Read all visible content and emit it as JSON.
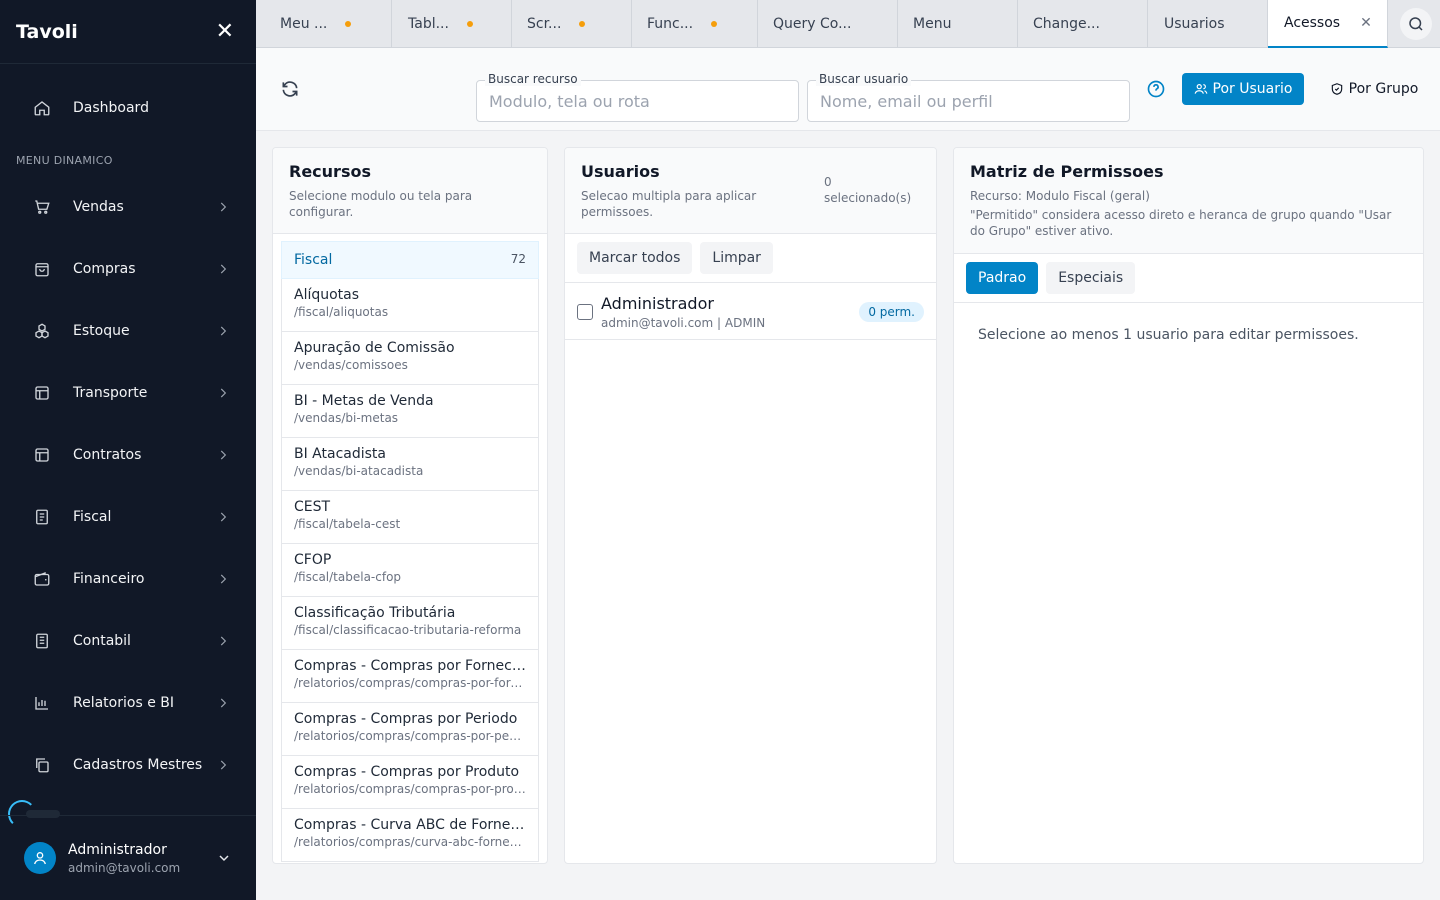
{
  "app": {
    "name": "Tavoli"
  },
  "sidebar": {
    "dashboard": "Dashboard",
    "section_title": "MENU DINAMICO",
    "items": [
      {
        "label": "Vendas",
        "icon": "cart-icon"
      },
      {
        "label": "Compras",
        "icon": "shopping-bag-icon"
      },
      {
        "label": "Estoque",
        "icon": "boxes-icon"
      },
      {
        "label": "Transporte",
        "icon": "layout-icon"
      },
      {
        "label": "Contratos",
        "icon": "layout-icon"
      },
      {
        "label": "Fiscal",
        "icon": "document-icon"
      },
      {
        "label": "Financeiro",
        "icon": "wallet-icon"
      },
      {
        "label": "Contabil",
        "icon": "ledger-icon"
      },
      {
        "label": "Relatorios e BI",
        "icon": "bar-chart-icon"
      },
      {
        "label": "Cadastros Mestres",
        "icon": "copy-icon"
      }
    ],
    "user": {
      "name": "Administrador",
      "email": "admin@tavoli.com"
    }
  },
  "tabs": [
    {
      "label": "Meu ...",
      "dirty": true
    },
    {
      "label": "Tabl...",
      "dirty": true
    },
    {
      "label": "Scr...",
      "dirty": true
    },
    {
      "label": "Func...",
      "dirty": true
    },
    {
      "label": "Query Co...",
      "dirty": false
    },
    {
      "label": "Menu",
      "dirty": false
    },
    {
      "label": "Change...",
      "dirty": false
    },
    {
      "label": "Usuarios",
      "dirty": false
    },
    {
      "label": "Acessos",
      "dirty": false,
      "active": true
    }
  ],
  "toolbar": {
    "search_resource": {
      "label": "Buscar recurso",
      "placeholder": "Modulo, tela ou rota",
      "value": ""
    },
    "search_user": {
      "label": "Buscar usuario",
      "placeholder": "Nome, email ou perfil",
      "value": ""
    },
    "by_user": "Por Usuario",
    "by_group": "Por Grupo"
  },
  "resources": {
    "title": "Recursos",
    "subtitle": "Selecione modulo ou tela para configurar.",
    "selected": {
      "name": "Fiscal",
      "count": "72"
    },
    "items": [
      {
        "name": "Alíquotas",
        "path": "/fiscal/aliquotas"
      },
      {
        "name": "Apuração de Comissão",
        "path": "/vendas/comissoes"
      },
      {
        "name": "BI - Metas de Venda",
        "path": "/vendas/bi-metas"
      },
      {
        "name": "BI Atacadista",
        "path": "/vendas/bi-atacadista"
      },
      {
        "name": "CEST",
        "path": "/fiscal/tabela-cest"
      },
      {
        "name": "CFOP",
        "path": "/fiscal/tabela-cfop"
      },
      {
        "name": "Classificação Tributária",
        "path": "/fiscal/classificacao-tributaria-reforma"
      },
      {
        "name": "Compras - Compras por Fornecedor",
        "path": "/relatorios/compras/compras-por-fornecedor"
      },
      {
        "name": "Compras - Compras por Periodo",
        "path": "/relatorios/compras/compras-por-periodo"
      },
      {
        "name": "Compras - Compras por Produto",
        "path": "/relatorios/compras/compras-por-produto"
      },
      {
        "name": "Compras - Curva ABC de Fornecedores",
        "path": "/relatorios/compras/curva-abc-fornecedores"
      }
    ]
  },
  "users": {
    "title": "Usuarios",
    "subtitle": "Selecao multipla para aplicar permissoes.",
    "selected_count": "0 selecionado(s)",
    "mark_all": "Marcar todos",
    "clear": "Limpar",
    "list": [
      {
        "name": "Administrador",
        "meta": "admin@tavoli.com | ADMIN",
        "perm": "0 perm."
      }
    ]
  },
  "matrix": {
    "title": "Matriz de Permissoes",
    "resource": "Recurso: Modulo Fiscal (geral)",
    "note": "\"Permitido\" considera acesso direto e heranca de grupo quando \"Usar do Grupo\" estiver ativo.",
    "tabs": [
      "Padrao",
      "Especiais"
    ],
    "empty": "Selecione ao menos 1 usuario para editar permissoes."
  },
  "colors": {
    "accent": "#0284c7",
    "sidebar_bg": "#111827",
    "dirty_dot": "#f59e0b"
  }
}
